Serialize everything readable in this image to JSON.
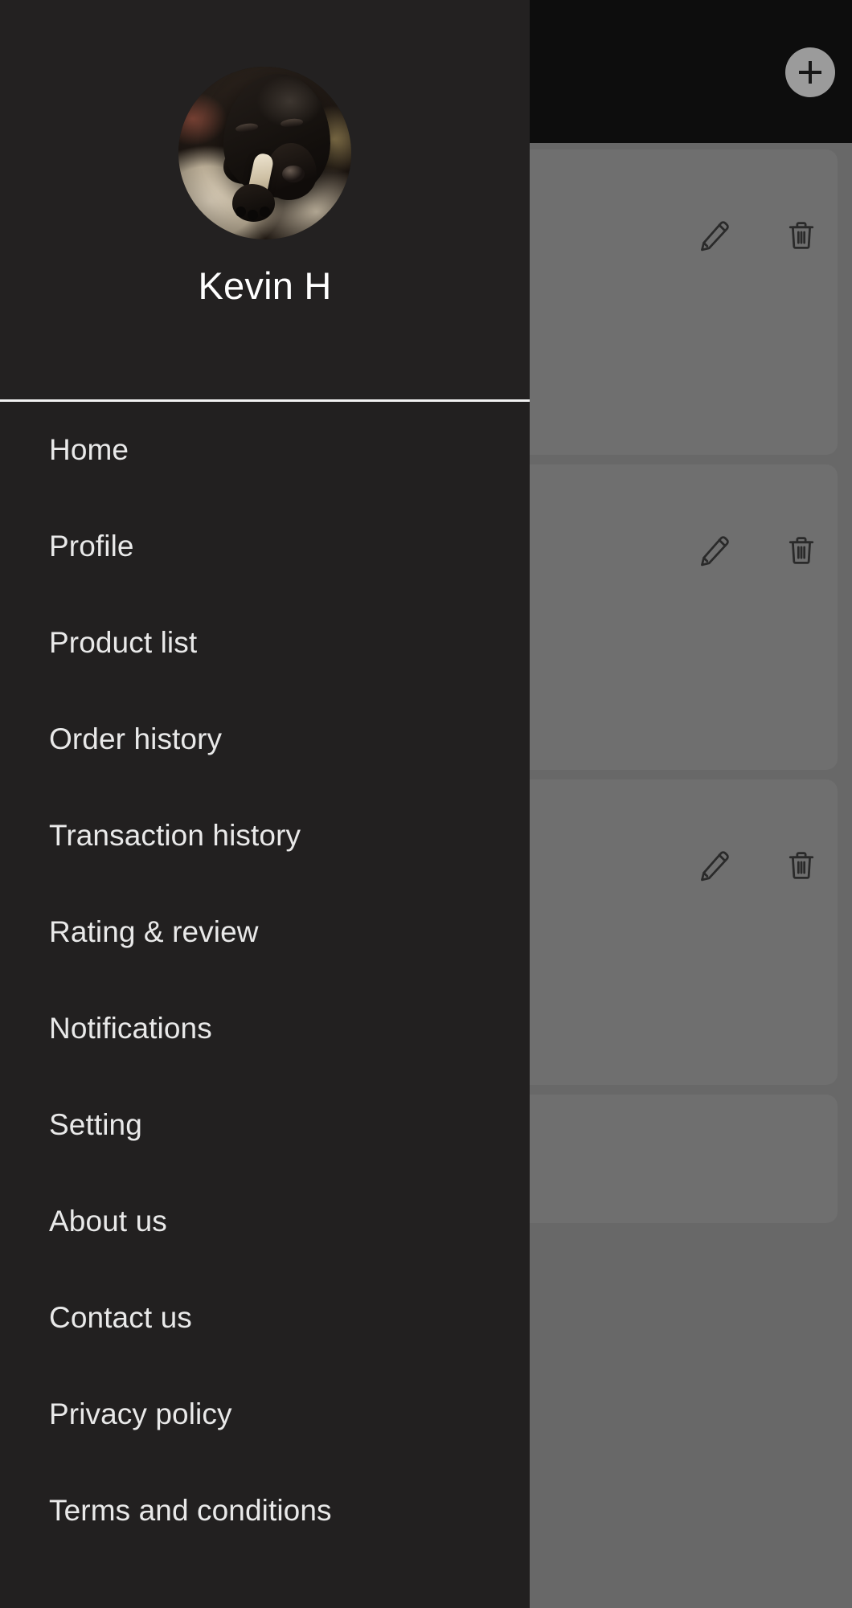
{
  "app": {
    "topbar": {
      "add_button_label": "+",
      "add_icon": "plus-icon"
    },
    "cards": [
      {
        "edit_icon": "pencil-icon",
        "delete_icon": "trash-icon"
      },
      {
        "edit_icon": "pencil-icon",
        "delete_icon": "trash-icon"
      },
      {
        "edit_icon": "pencil-icon",
        "delete_icon": "trash-icon"
      }
    ]
  },
  "drawer": {
    "profile": {
      "name": "Kevin H",
      "avatar_icon": "user-avatar-dog-photo"
    },
    "items": [
      {
        "label": "Home"
      },
      {
        "label": "Profile"
      },
      {
        "label": "Product list"
      },
      {
        "label": "Order history"
      },
      {
        "label": "Transaction history"
      },
      {
        "label": "Rating & review"
      },
      {
        "label": "Notifications"
      },
      {
        "label": "Setting"
      },
      {
        "label": "About us"
      },
      {
        "label": "Contact us"
      },
      {
        "label": "Privacy policy"
      },
      {
        "label": "Terms and conditions"
      }
    ]
  },
  "colors": {
    "drawer_bg": "#222020",
    "topbar_bg": "#0d0d0d",
    "scrim": "#686868",
    "card_bg": "#6f6f6f",
    "divider": "#f2f2f2",
    "text": "#e9e9e9",
    "fab_bg": "#9b9b9b"
  }
}
